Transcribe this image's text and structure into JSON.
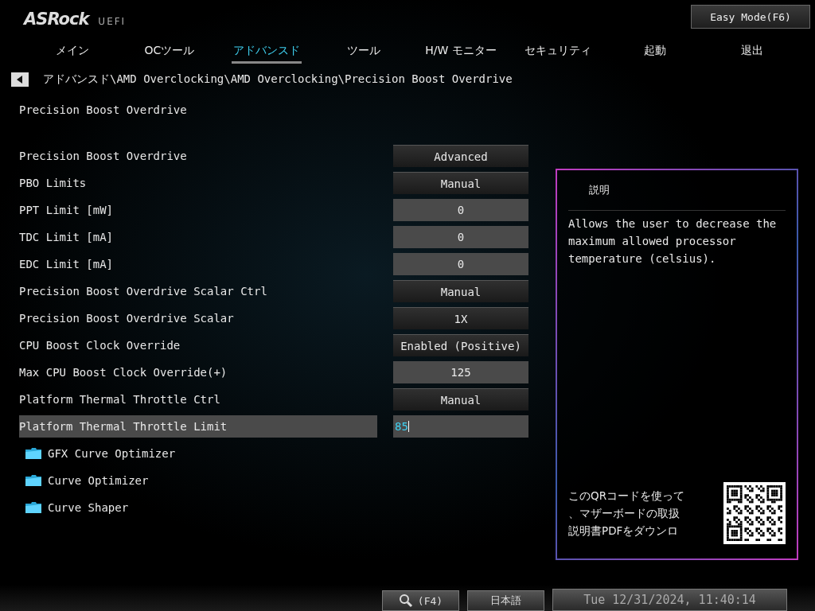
{
  "header": {
    "logo": "ASRock",
    "logo_suffix": "UEFI",
    "easy_mode_button": "Easy Mode(F6)"
  },
  "tabs": [
    {
      "label": "メイン",
      "selected": false
    },
    {
      "label": "OCツール",
      "selected": false
    },
    {
      "label": "アドバンスド",
      "selected": true
    },
    {
      "label": "ツール",
      "selected": false
    },
    {
      "label": "H/W モニター",
      "selected": false
    },
    {
      "label": "セキュリティ",
      "selected": false
    },
    {
      "label": "起動",
      "selected": false
    },
    {
      "label": "退出",
      "selected": false
    }
  ],
  "breadcrumb": {
    "path": "アドバンスド\\AMD Overclocking\\AMD Overclocking\\Precision Boost Overdrive"
  },
  "section_title": "Precision Boost Overdrive",
  "settings": [
    {
      "label": "Precision Boost Overdrive",
      "value": "Advanced",
      "kind": "option",
      "selected": false
    },
    {
      "label": "PBO Limits",
      "value": "Manual",
      "kind": "option",
      "selected": false
    },
    {
      "label": "PPT Limit [mW]",
      "value": "0",
      "kind": "number",
      "selected": false
    },
    {
      "label": "TDC Limit [mA]",
      "value": "0",
      "kind": "number",
      "selected": false
    },
    {
      "label": "EDC Limit [mA]",
      "value": "0",
      "kind": "number",
      "selected": false
    },
    {
      "label": "Precision Boost Overdrive Scalar Ctrl",
      "value": "Manual",
      "kind": "option",
      "selected": false
    },
    {
      "label": "Precision Boost Overdrive Scalar",
      "value": "1X",
      "kind": "option",
      "selected": false
    },
    {
      "label": "CPU Boost Clock Override",
      "value": "Enabled (Positive)",
      "kind": "option",
      "selected": false
    },
    {
      "label": "Max CPU Boost Clock Override(+)",
      "value": "125",
      "kind": "number",
      "selected": false
    },
    {
      "label": "Platform Thermal Throttle Ctrl",
      "value": "Manual",
      "kind": "option",
      "selected": false
    },
    {
      "label": "Platform Thermal Throttle Limit",
      "value": "85",
      "kind": "number",
      "selected": true
    }
  ],
  "submenus": [
    {
      "label": "GFX Curve Optimizer"
    },
    {
      "label": "Curve Optimizer"
    },
    {
      "label": "Curve Shaper"
    }
  ],
  "help_panel": {
    "title": "説明",
    "text": "Allows the user to decrease the maximum allowed processor temperature (celsius).",
    "qr_caption": [
      "このQRコードを使って",
      "、マザーボードの取扱",
      "説明書PDFをダウンロ"
    ]
  },
  "status_bar": {
    "search_button": "(F4)",
    "language_button": "日本語",
    "datetime": "Tue 12/31/2024, 11:40:14"
  }
}
